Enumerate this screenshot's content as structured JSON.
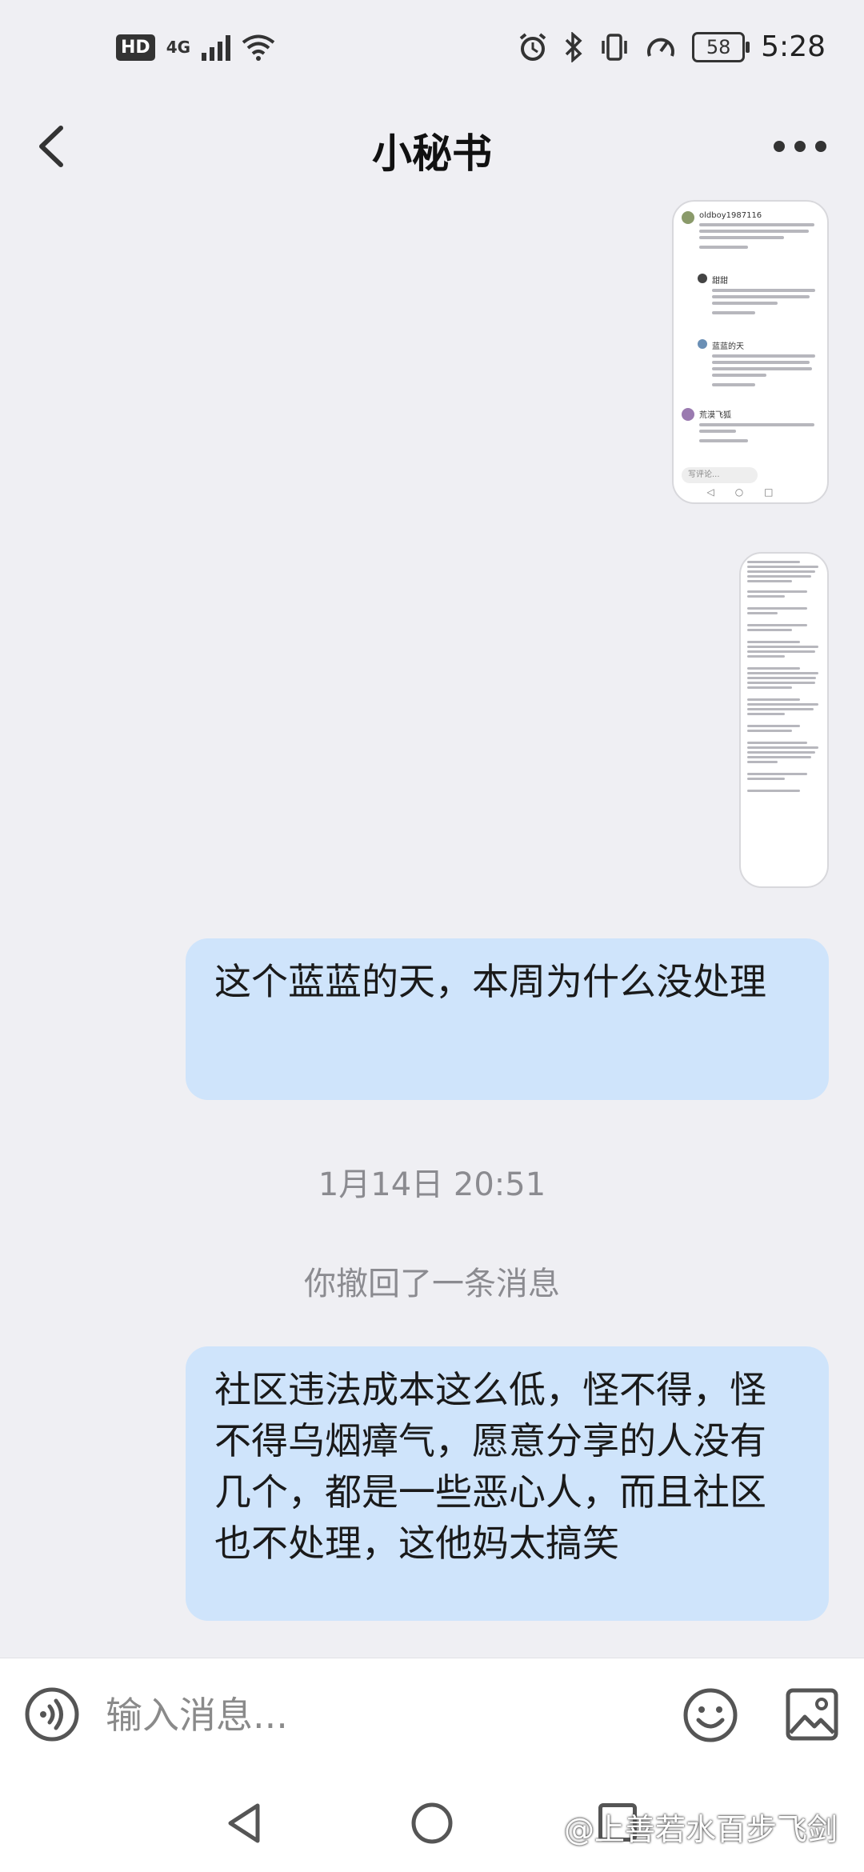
{
  "status_bar": {
    "hd": "HD",
    "network": "4G",
    "battery": "58",
    "time": "5:28"
  },
  "header": {
    "title": "小秘书"
  },
  "thumbnail1": {
    "entries": [
      {
        "name": "oldboy1987116"
      },
      {
        "name": "甜甜"
      },
      {
        "name": "蓝蓝的天"
      },
      {
        "name": "荒漠飞狐"
      }
    ],
    "input_placeholder": "写评论..."
  },
  "messages": [
    {
      "type": "sent",
      "text": "这个蓝蓝的天，本周为什么没处理"
    },
    {
      "type": "timestamp",
      "text": "1月14日 20:51"
    },
    {
      "type": "system",
      "text": "你撤回了一条消息"
    },
    {
      "type": "sent",
      "text": "社区违法成本这么低，怪不得，怪不得乌烟瘴气，愿意分享的人没有几个，都是一些恶心人，而且社区也不处理，这他妈太搞笑"
    }
  ],
  "input_bar": {
    "placeholder": "输入消息..."
  },
  "watermark": "@上善若水百步飞剑",
  "icons": [
    "back-arrow-icon",
    "more-dots-icon",
    "voice-icon",
    "emoji-icon",
    "image-icon",
    "nav-back-icon",
    "nav-home-icon",
    "nav-recent-icon"
  ],
  "colors": {
    "background": "#efeff3",
    "bubble": "#cfe4fb",
    "system_text": "#8b8b90"
  }
}
